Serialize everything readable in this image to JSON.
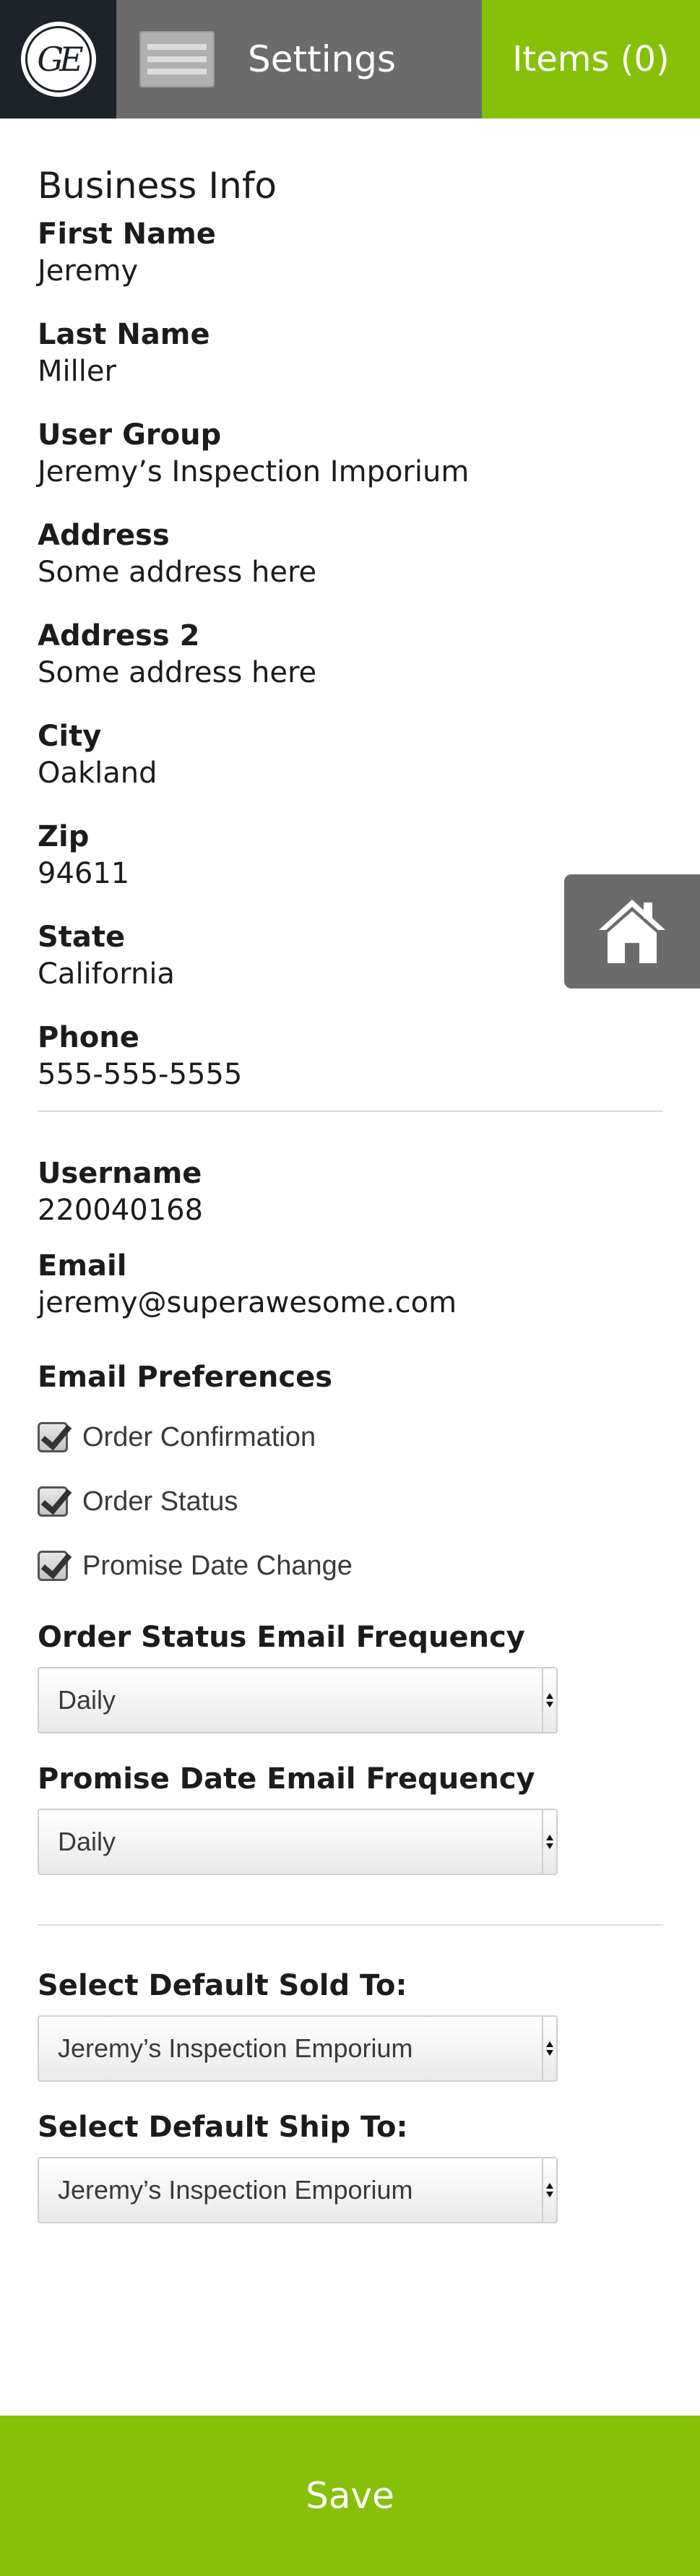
{
  "header": {
    "logo": "GE monogram",
    "logo_text": "GE",
    "title": "Settings",
    "items_label": "Items (0)"
  },
  "business_info": {
    "section_title": "Business Info",
    "fields": [
      {
        "label": "First Name",
        "value": "Jeremy"
      },
      {
        "label": "Last Name",
        "value": "Miller"
      },
      {
        "label": "User Group",
        "value": "Jeremy’s Inspection Imporium"
      },
      {
        "label": "Address",
        "value": "Some address here"
      },
      {
        "label": "Address 2",
        "value": "Some address here"
      },
      {
        "label": "City",
        "value": "Oakland"
      },
      {
        "label": "Zip",
        "value": "94611"
      },
      {
        "label": "State",
        "value": "California"
      },
      {
        "label": "Phone",
        "value": "555-555-5555"
      }
    ]
  },
  "account": {
    "username_label": "Username",
    "username": "220040168",
    "email_label": "Email",
    "email": "jeremy@superawesome.com"
  },
  "email_preferences": {
    "title": "Email Preferences",
    "options": [
      {
        "label": "Order Confirmation",
        "checked": true
      },
      {
        "label": "Order Status",
        "checked": true
      },
      {
        "label": "Promise Date Change",
        "checked": true
      }
    ]
  },
  "frequency": {
    "order_status_label": "Order Status Email Frequency",
    "order_status_value": "Daily",
    "promise_date_label": "Promise Date Email Frequency",
    "promise_date_value": "Daily"
  },
  "defaults": {
    "sold_to_label": "Select Default Sold To:",
    "sold_to_value": "Jeremy’s Inspection Emporium",
    "ship_to_label": "Select Default Ship To:",
    "ship_to_value": "Jeremy’s Inspection Emporium"
  },
  "save_label": "Save",
  "colors": {
    "accent_green": "#86c007",
    "header_gray": "#6b6b6b",
    "logo_bg": "#1e2229"
  }
}
